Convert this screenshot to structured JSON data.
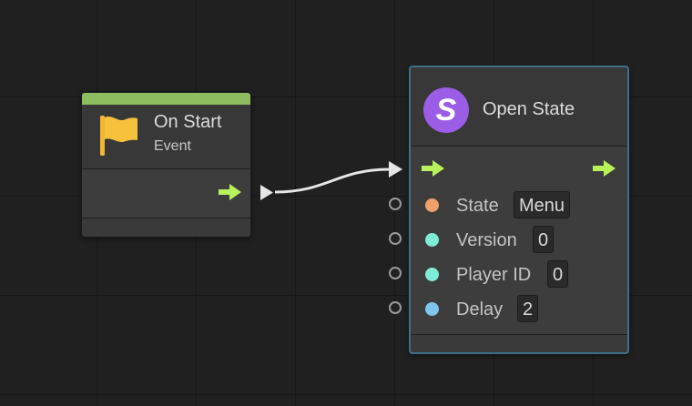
{
  "nodes": {
    "on_start": {
      "title": "On Start",
      "subtitle": "Event",
      "icon": "flag-icon",
      "accent_color": "#8cbd5f"
    },
    "open_state": {
      "title": "Open State",
      "icon_letter": "S",
      "icon_color": "#9b5de5",
      "border_color": "#3f6e8a",
      "inputs": [
        {
          "label": "State",
          "value": "Menu",
          "port_color": "#f0a06a"
        },
        {
          "label": "Version",
          "value": "0",
          "port_color": "#7eecd6"
        },
        {
          "label": "Player ID",
          "value": "0",
          "port_color": "#7eecd6"
        },
        {
          "label": "Delay",
          "value": "2",
          "port_color": "#7fc6ef"
        }
      ]
    }
  },
  "colors": {
    "flow_arrow": "#b7f25a",
    "wire": "#e6e6e6",
    "canvas": "#202020"
  }
}
